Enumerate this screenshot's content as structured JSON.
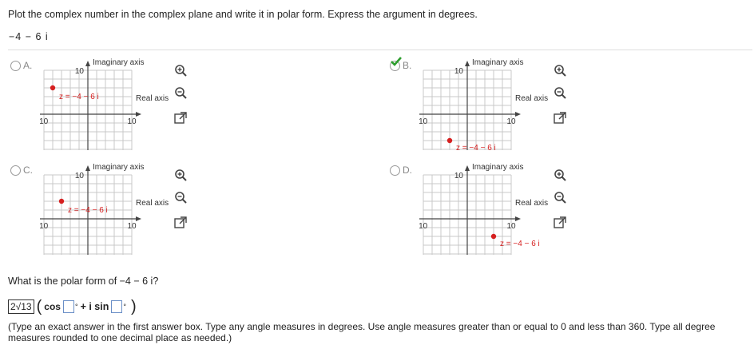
{
  "prompt": "Plot the complex number in the complex plane and write it in polar form.  Express the argument in degrees.",
  "expression": "−4 − 6 i",
  "graph_labels": {
    "imag_axis": "Imaginary axis",
    "real_axis": "Real axis",
    "pos_tick": "10",
    "neg_tick": "-10"
  },
  "options": [
    {
      "letter": "A.",
      "point_label": "z = −4 − 6 i",
      "point": {
        "x": -8,
        "y": 6
      },
      "selected": false
    },
    {
      "letter": "B.",
      "point_label": "z = −4 − 6 i",
      "point": {
        "x": -4,
        "y": -6
      },
      "selected": true
    },
    {
      "letter": "C.",
      "point_label": "z = −4 − 6 i",
      "point": {
        "x": -6,
        "y": 4
      },
      "selected": false
    },
    {
      "letter": "D.",
      "point_label": "z = −4 − 6 i",
      "point": {
        "x": 6,
        "y": -4
      },
      "selected": false
    }
  ],
  "question": "What is the polar form of  −4 − 6 i?",
  "answer": {
    "coefficient": "2√13",
    "cos_label": "cos",
    "plus_i_sin": "+ i sin",
    "degree_symbol": "°"
  },
  "instructions": "(Type an exact answer in the first answer box. Type any angle measures in degrees. Use angle measures greater than or equal to 0 and less than 360. Type all degree measures rounded to one decimal place as needed.)",
  "colors": {
    "point": "#d62020",
    "label": "#d62020",
    "check": "#2e9e2e",
    "grid": "#c8c8c8",
    "axis": "#444"
  },
  "icons": [
    "zoom-in-icon",
    "zoom-out-icon",
    "popout-icon",
    "checkmark-icon"
  ]
}
